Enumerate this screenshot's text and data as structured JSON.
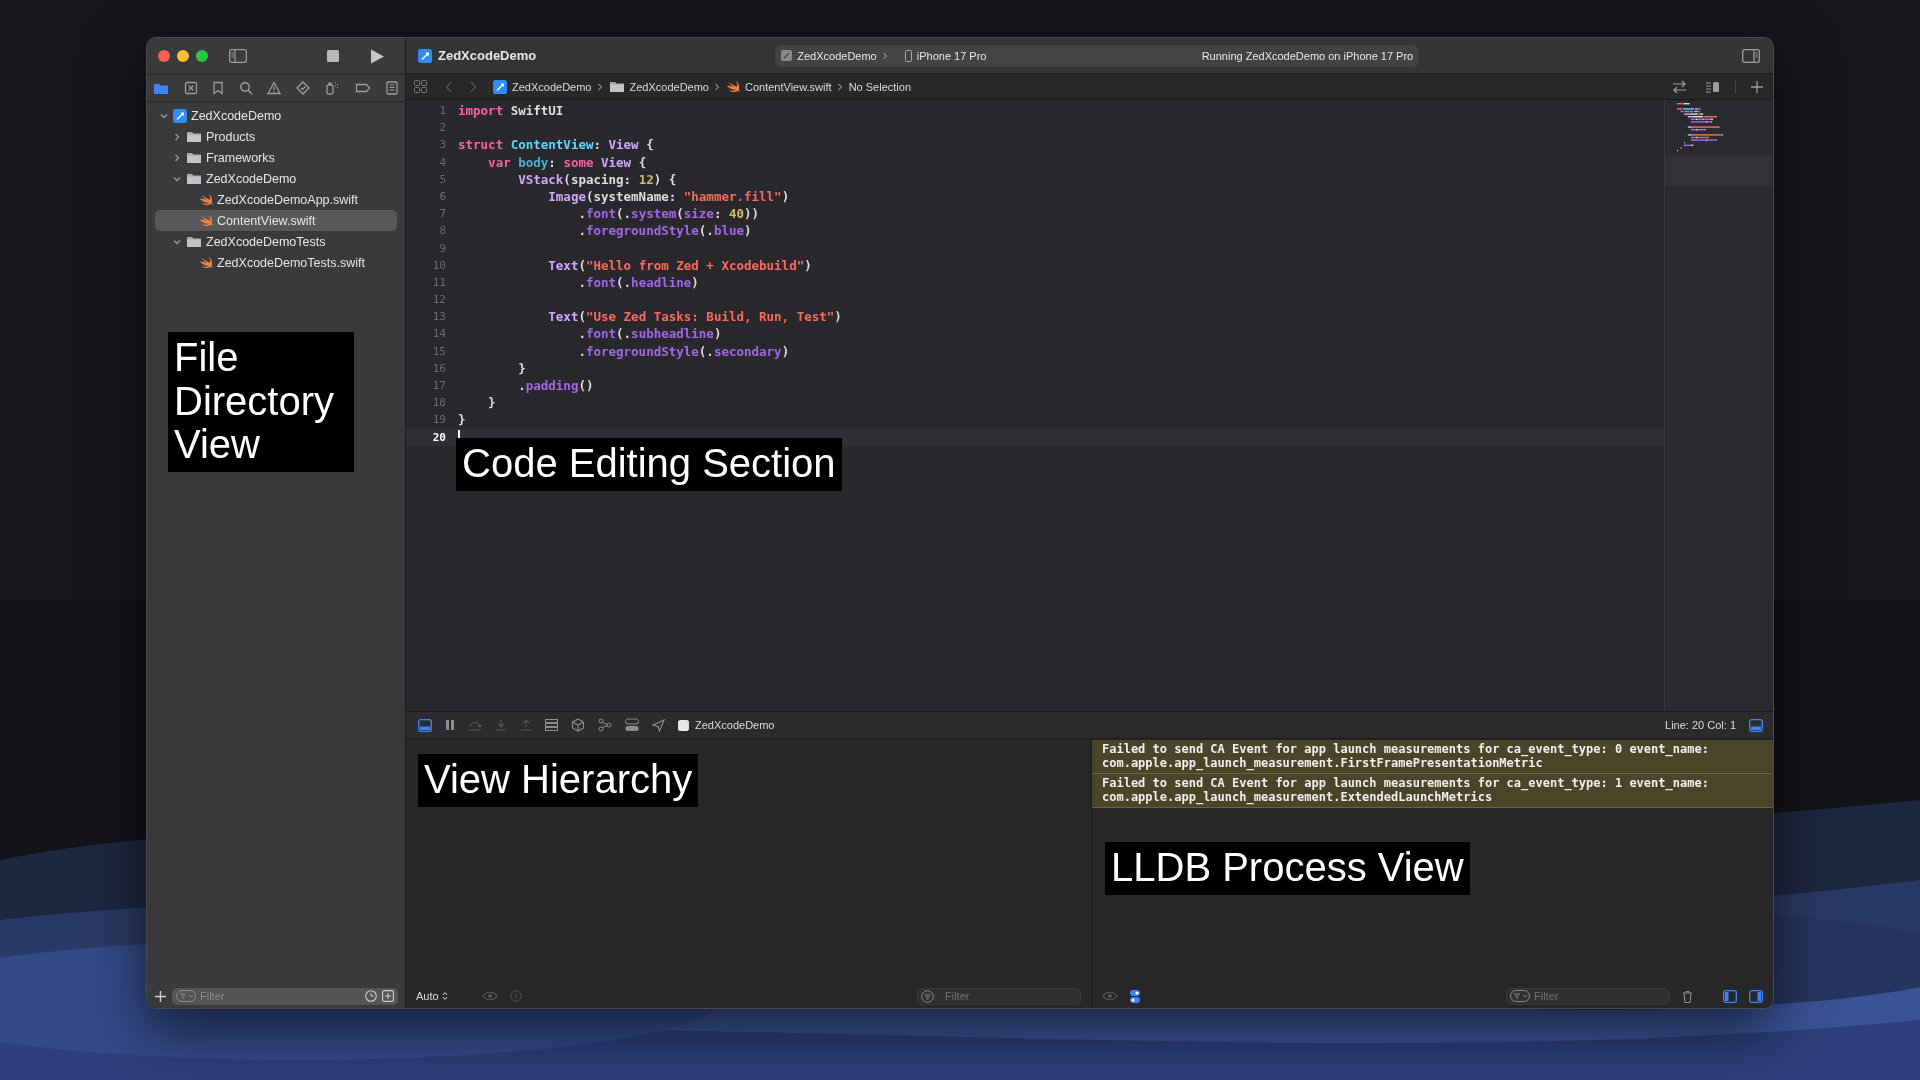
{
  "window": {
    "title": "ZedXcodeDemo",
    "scheme": {
      "target": "ZedXcodeDemo",
      "device": "iPhone 17 Pro"
    },
    "status": "Running ZedXcodeDemo on iPhone 17 Pro"
  },
  "navigator_tabs": [
    {
      "kind": "folder",
      "selected": true
    },
    {
      "kind": "source-control",
      "selected": false
    },
    {
      "kind": "bookmark",
      "selected": false
    },
    {
      "kind": "search",
      "selected": false
    },
    {
      "kind": "warning",
      "selected": false
    },
    {
      "kind": "test",
      "selected": false
    },
    {
      "kind": "debug",
      "selected": false
    },
    {
      "kind": "breakpoint",
      "selected": false
    },
    {
      "kind": "report",
      "selected": false
    }
  ],
  "navigator": {
    "items": [
      {
        "label": "ZedXcodeDemo",
        "kind": "project",
        "expanded": true,
        "selected": false,
        "children": [
          {
            "label": "Products",
            "kind": "folder",
            "expanded": false,
            "selected": false
          },
          {
            "label": "Frameworks",
            "kind": "folder",
            "expanded": false,
            "selected": false
          },
          {
            "label": "ZedXcodeDemo",
            "kind": "folder",
            "expanded": true,
            "selected": false,
            "children": [
              {
                "label": "ZedXcodeDemoApp.swift",
                "kind": "swift",
                "selected": false
              },
              {
                "label": "ContentView.swift",
                "kind": "swift",
                "selected": true
              }
            ]
          },
          {
            "label": "ZedXcodeDemoTests",
            "kind": "folder",
            "expanded": true,
            "selected": false,
            "children": [
              {
                "label": "ZedXcodeDemoTests.swift",
                "kind": "swift",
                "selected": false
              }
            ]
          }
        ]
      }
    ],
    "annotation": "File Directory View",
    "filter_placeholder": "Filter"
  },
  "jump_bar": [
    {
      "label": "ZedXcodeDemo",
      "kind": "project"
    },
    {
      "label": "ZedXcodeDemo",
      "kind": "folder"
    },
    {
      "label": "ContentView.swift",
      "kind": "swift"
    },
    {
      "label": "No Selection",
      "kind": "plain"
    }
  ],
  "editor": {
    "annotation": "Code Editing Section",
    "lines": [
      {
        "number": "1",
        "current": false,
        "tokens": [
          {
            "text": "import",
            "kind": "keyword"
          },
          {
            "text": " SwiftUI",
            "kind": "plain"
          }
        ]
      },
      {
        "number": "2",
        "current": false
      },
      {
        "number": "3",
        "current": false,
        "tokens": [
          {
            "text": "struct",
            "kind": "keyword"
          },
          {
            "text": " ContentView",
            "kind": "declaration"
          },
          {
            "text": ": ",
            "kind": "plain"
          },
          {
            "text": "View",
            "kind": "type"
          },
          {
            "text": " {",
            "kind": "plain"
          }
        ]
      },
      {
        "number": "4",
        "current": false,
        "tokens": [
          {
            "text": "    var",
            "kind": "keyword"
          },
          {
            "text": " body",
            "kind": "property"
          },
          {
            "text": ": ",
            "kind": "plain"
          },
          {
            "text": "some",
            "kind": "keyword"
          },
          {
            "text": " View",
            "kind": "type"
          },
          {
            "text": " {",
            "kind": "plain"
          }
        ]
      },
      {
        "number": "5",
        "current": false,
        "tokens": [
          {
            "text": "        VStack",
            "kind": "type"
          },
          {
            "text": "(spacing: ",
            "kind": "plain"
          },
          {
            "text": "12",
            "kind": "number"
          },
          {
            "text": ") {",
            "kind": "plain"
          }
        ]
      },
      {
        "number": "6",
        "current": false,
        "tokens": [
          {
            "text": "            Image",
            "kind": "type"
          },
          {
            "text": "(systemName: ",
            "kind": "plain"
          },
          {
            "text": "\"hammer.fill\"",
            "kind": "string"
          },
          {
            "text": ")",
            "kind": "plain"
          }
        ]
      },
      {
        "number": "7",
        "current": false,
        "tokens": [
          {
            "text": "                .",
            "kind": "plain"
          },
          {
            "text": "font",
            "kind": "method"
          },
          {
            "text": "(.",
            "kind": "plain"
          },
          {
            "text": "system",
            "kind": "method"
          },
          {
            "text": "(",
            "kind": "plain"
          },
          {
            "text": "size",
            "kind": "method"
          },
          {
            "text": ": ",
            "kind": "plain"
          },
          {
            "text": "40",
            "kind": "number"
          },
          {
            "text": "))",
            "kind": "plain"
          }
        ]
      },
      {
        "number": "8",
        "current": false,
        "tokens": [
          {
            "text": "                .",
            "kind": "plain"
          },
          {
            "text": "foregroundStyle",
            "kind": "method"
          },
          {
            "text": "(.",
            "kind": "plain"
          },
          {
            "text": "blue",
            "kind": "method"
          },
          {
            "text": ")",
            "kind": "plain"
          }
        ]
      },
      {
        "number": "9",
        "current": false
      },
      {
        "number": "10",
        "current": false,
        "tokens": [
          {
            "text": "            Text",
            "kind": "type"
          },
          {
            "text": "(",
            "kind": "plain"
          },
          {
            "text": "\"Hello from Zed + Xcodebuild\"",
            "kind": "string"
          },
          {
            "text": ")",
            "kind": "plain"
          }
        ]
      },
      {
        "number": "11",
        "current": false,
        "tokens": [
          {
            "text": "                .",
            "kind": "plain"
          },
          {
            "text": "font",
            "kind": "method"
          },
          {
            "text": "(.",
            "kind": "plain"
          },
          {
            "text": "headline",
            "kind": "method"
          },
          {
            "text": ")",
            "kind": "plain"
          }
        ]
      },
      {
        "number": "12",
        "current": false
      },
      {
        "number": "13",
        "current": false,
        "tokens": [
          {
            "text": "            Text",
            "kind": "type"
          },
          {
            "text": "(",
            "kind": "plain"
          },
          {
            "text": "\"Use Zed Tasks: Build, Run, Test\"",
            "kind": "string"
          },
          {
            "text": ")",
            "kind": "plain"
          }
        ]
      },
      {
        "number": "14",
        "current": false,
        "tokens": [
          {
            "text": "                .",
            "kind": "plain"
          },
          {
            "text": "font",
            "kind": "method"
          },
          {
            "text": "(.",
            "kind": "plain"
          },
          {
            "text": "subheadline",
            "kind": "method"
          },
          {
            "text": ")",
            "kind": "plain"
          }
        ]
      },
      {
        "number": "15",
        "current": false,
        "tokens": [
          {
            "text": "                .",
            "kind": "plain"
          },
          {
            "text": "foregroundStyle",
            "kind": "method"
          },
          {
            "text": "(.",
            "kind": "plain"
          },
          {
            "text": "secondary",
            "kind": "method"
          },
          {
            "text": ")",
            "kind": "plain"
          }
        ]
      },
      {
        "number": "16",
        "current": false,
        "tokens": [
          {
            "text": "        }",
            "kind": "plain"
          }
        ]
      },
      {
        "number": "17",
        "current": false,
        "tokens": [
          {
            "text": "        .",
            "kind": "plain"
          },
          {
            "text": "padding",
            "kind": "method"
          },
          {
            "text": "()",
            "kind": "plain"
          }
        ]
      },
      {
        "number": "18",
        "current": false,
        "tokens": [
          {
            "text": "    }",
            "kind": "plain"
          }
        ]
      },
      {
        "number": "19",
        "current": false,
        "tokens": [
          {
            "text": "}",
            "kind": "plain"
          }
        ]
      },
      {
        "number": "20",
        "current": true
      }
    ]
  },
  "debug_bar": {
    "process": "ZedXcodeDemo",
    "position": "Line: 20  Col: 1"
  },
  "variables": {
    "annotation": "View Hierarchy",
    "mode": "Auto",
    "filter_placeholder": "Filter"
  },
  "console": {
    "messages": [
      "Failed to send CA Event for app launch measurements for ca_event_type: 0 event_name: com.apple.app_launch_measurement.FirstFramePresentationMetric",
      "Failed to send CA Event for app launch measurements for ca_event_type: 1 event_name: com.apple.app_launch_measurement.ExtendedLaunchMetrics"
    ],
    "annotation": "LLDB Process View",
    "filter_placeholder": "Filter"
  }
}
